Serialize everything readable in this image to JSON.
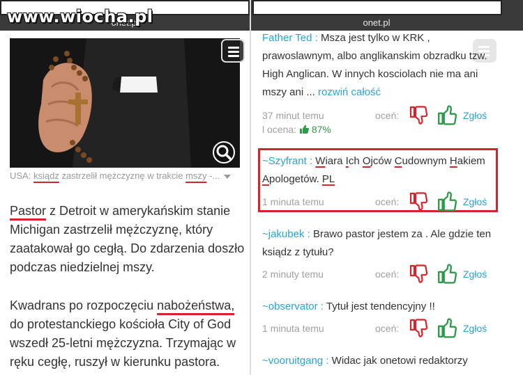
{
  "left": {
    "watermark": "www.wiocha.pl",
    "url": "onet.pl",
    "caption_prefix": "USA: ",
    "caption_w1": "ksiądz",
    "caption_mid": " zastrzelił mężczyznę w trakcie ",
    "caption_w2": "mszy",
    "caption_suffix": " -...",
    "para1_w1": "Pastor",
    "para1_rest": " z Detroit w amerykańskim stanie Michigan zastrzelił mężczyznę, który zaatakował go cegłą. Do zdarzenia doszło podczas niedzielnej mszy.",
    "para2_pre": "Kwadrans po rozpoczęciu ",
    "para2_w": "nabożeństwa,",
    "para2_rest": " do protestanckiego kościoła City of God wszedł 25-letni mężczyzna. Trzymając w ręku cegłę, ruszył w kierunku pastora."
  },
  "right": {
    "url": "onet.pl",
    "comments": [
      {
        "author": "Father Ted :",
        "text": " Msza jest tylko w KRK , prawoslawnym, albo anglikanskim obzradku tzw. High Anglican. W innych kosciolach nie ma ani mszy ani ... ",
        "expand": "rozwiń całość",
        "time": "37 minut temu",
        "rate": "oceń:",
        "report": "Zgłoś",
        "score_label": "l ocena:",
        "score_value": "87%"
      },
      {
        "author": "~Szyfrant :",
        "text_parts": [
          " ",
          "W",
          "iara ",
          "I",
          "ch ",
          "O",
          "jców ",
          "C",
          "udownym ",
          "H",
          "akiem ",
          "A",
          "pologetów. ",
          "PL"
        ],
        "time": "1 minuta temu",
        "rate": "oceń:",
        "report": "Zgłoś"
      },
      {
        "author": "~jakubek :",
        "text": " Brawo pastor jestem za . Ale gdzie ten ksiądz z tytułu?",
        "time": "2 minuty temu",
        "rate": "oceń:",
        "report": "Zgłoś"
      },
      {
        "author": "~observator :",
        "text": " Tytuł jest tendencyjny !!",
        "time": "1 minuta temu",
        "rate": "oceń:",
        "report": "Zgłoś"
      },
      {
        "author": "~vooruitgang :",
        "text": " Widac jak onetowi redaktorzy"
      }
    ]
  },
  "colors": {
    "accent_blue": "#29a3d6",
    "highlight_red": "#d8232a",
    "thumb_down": "#d8232a",
    "thumb_up": "#2f9a4a",
    "url_bar": "#3a3a3a"
  },
  "icons": [
    "menu-icon",
    "zoom-icon",
    "thumbs-down-icon",
    "thumbs-up-icon"
  ]
}
